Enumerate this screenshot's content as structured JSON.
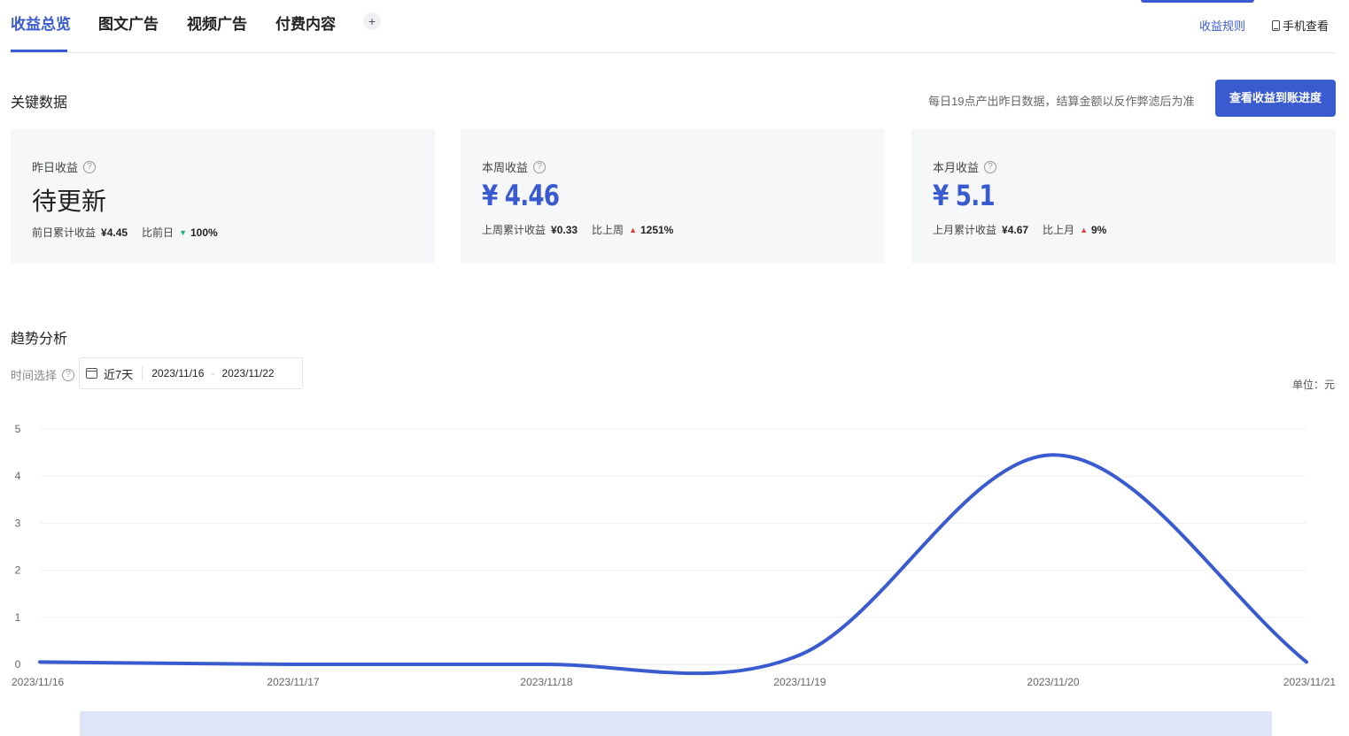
{
  "tabs": [
    {
      "label": "收益总览",
      "active": true
    },
    {
      "label": "图文广告",
      "active": false
    },
    {
      "label": "视频广告",
      "active": false
    },
    {
      "label": "付费内容",
      "active": false
    }
  ],
  "tab_add_label": "+",
  "header_links": {
    "rules": "收益规则",
    "mobile": "手机查看"
  },
  "key_data": {
    "title": "关键数据",
    "note": "每日19点产出昨日数据，结算金额以反作弊滤后为准",
    "button": "查看收益到账进度"
  },
  "cards": [
    {
      "label": "昨日收益",
      "value": "待更新",
      "sub_label": "前日累计收益",
      "sub_value": "¥4.45",
      "cmp_label": "比前日",
      "cmp_dir": "down",
      "cmp_value": "100%"
    },
    {
      "label": "本周收益",
      "value": "¥ 4.46",
      "sub_label": "上周累计收益",
      "sub_value": "¥0.33",
      "cmp_label": "比上周",
      "cmp_dir": "up",
      "cmp_value": "1251%"
    },
    {
      "label": "本月收益",
      "value": "¥ 5.1",
      "sub_label": "上月累计收益",
      "sub_value": "¥4.67",
      "cmp_label": "比上月",
      "cmp_dir": "up",
      "cmp_value": "9%"
    }
  ],
  "trend": {
    "title": "趋势分析",
    "time_label": "时间选择",
    "range_label": "近7天",
    "start_date": "2023/11/16",
    "end_date": "2023/11/22",
    "range_sep": "-",
    "unit": "单位：元"
  },
  "colors": {
    "accent": "#3a5bd0",
    "up": "#e23c39",
    "down": "#19b37a",
    "card_bg": "#f6f7f8"
  },
  "chart_data": {
    "type": "line",
    "x": [
      "2023/11/16",
      "2023/11/17",
      "2023/11/18",
      "2023/11/19",
      "2023/11/20",
      "2023/11/21"
    ],
    "values": [
      0.05,
      0.0,
      0.0,
      0.2,
      4.45,
      0.05
    ],
    "ylim": [
      0,
      5
    ],
    "yticks": [
      0,
      1,
      2,
      3,
      4,
      5
    ],
    "grid": true,
    "smooth": true
  }
}
